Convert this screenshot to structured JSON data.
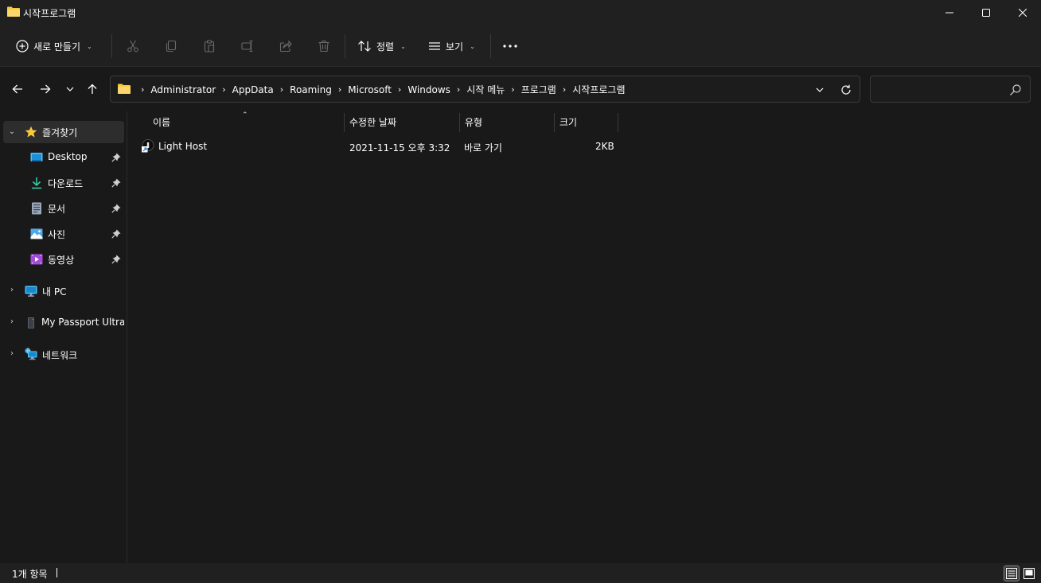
{
  "window": {
    "title": "시작프로그램",
    "minimize_icon": "minimize-icon",
    "maximize_icon": "maximize-icon",
    "close_icon": "close-icon"
  },
  "toolbar": {
    "new_label": "새로 만들기",
    "sort_label": "정렬",
    "view_label": "보기",
    "icons": [
      "cut-icon",
      "copy-icon",
      "paste-icon",
      "rename-icon",
      "share-icon",
      "delete-icon",
      "more-icon"
    ]
  },
  "address": {
    "crumbs": [
      "Administrator",
      "AppData",
      "Roaming",
      "Microsoft",
      "Windows",
      "시작 메뉴",
      "프로그램",
      "시작프로그램"
    ]
  },
  "search": {
    "value": "",
    "placeholder": ""
  },
  "sidebar": {
    "favorites": "즐겨찾기",
    "pinned": [
      {
        "label": "Desktop",
        "icon": "desktop-icon"
      },
      {
        "label": "다운로드",
        "icon": "download-icon"
      },
      {
        "label": "문서",
        "icon": "document-icon"
      },
      {
        "label": "사진",
        "icon": "pictures-icon"
      },
      {
        "label": "동영상",
        "icon": "videos-icon"
      }
    ],
    "this_pc": "내 PC",
    "drive": "My Passport Ultra (I",
    "network": "네트워크"
  },
  "columns": {
    "name": "이름",
    "modified": "수정한 날짜",
    "type": "유형",
    "size": "크기"
  },
  "files": [
    {
      "name": "Light Host",
      "modified": "2021-11-15 오후 3:32",
      "type": "바로 가기",
      "size": "2KB"
    }
  ],
  "status": {
    "count": "1개 항목"
  },
  "colors": {
    "background": "#191919",
    "chrome": "#202020",
    "folder_yellow": "#f8c93e",
    "accent_blue": "#4cc2ff"
  }
}
